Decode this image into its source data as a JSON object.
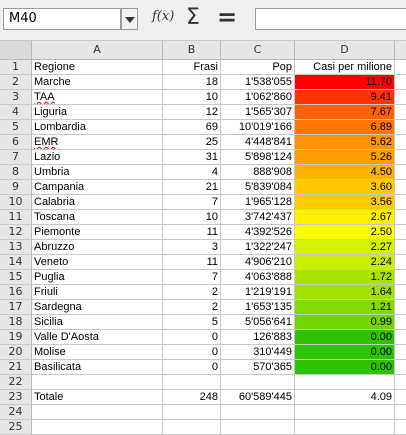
{
  "formula_bar": {
    "cell_ref": "M40",
    "fx_label": "f(x)",
    "sum_label": "Σ",
    "equals_label": "="
  },
  "columns": [
    "A",
    "B",
    "C",
    "D"
  ],
  "header_row": {
    "num": "1",
    "a": "Regione",
    "b": "Frasi",
    "c": "Pop",
    "d": "Casi per milione"
  },
  "rows": [
    {
      "num": "2",
      "a": "Marche",
      "b": "18",
      "c": "1'538'055",
      "d": "11.70",
      "color": "#ff0000"
    },
    {
      "num": "3",
      "a": "TAA",
      "b": "10",
      "c": "1'062'860",
      "d": "9.41",
      "color": "#ff3300"
    },
    {
      "num": "4",
      "a": "Liguria",
      "b": "12",
      "c": "1'565'307",
      "d": "7.67",
      "color": "#ff6200"
    },
    {
      "num": "5",
      "a": "Lombardia",
      "b": "69",
      "c": "10'019'166",
      "d": "6.89",
      "color": "#ff7600"
    },
    {
      "num": "6",
      "a": "EMR",
      "b": "25",
      "c": "4'448'841",
      "d": "5.62",
      "color": "#ff9400"
    },
    {
      "num": "7",
      "a": "Lazio",
      "b": "31",
      "c": "5'898'124",
      "d": "5.26",
      "color": "#ff9d00"
    },
    {
      "num": "8",
      "a": "Umbria",
      "b": "4",
      "c": "888'908",
      "d": "4.50",
      "color": "#ffb100"
    },
    {
      "num": "9",
      "a": "Campania",
      "b": "21",
      "c": "5'839'084",
      "d": "3.60",
      "color": "#ffc800"
    },
    {
      "num": "10",
      "a": "Calabria",
      "b": "7",
      "c": "1'965'128",
      "d": "3.56",
      "color": "#ffca00"
    },
    {
      "num": "11",
      "a": "Toscana",
      "b": "10",
      "c": "3'742'437",
      "d": "2.67",
      "color": "#fff000"
    },
    {
      "num": "12",
      "a": "Piemonte",
      "b": "11",
      "c": "4'392'526",
      "d": "2.50",
      "color": "#ffff00"
    },
    {
      "num": "13",
      "a": "Abruzzo",
      "b": "3",
      "c": "1'322'247",
      "d": "2.27",
      "color": "#d4f200"
    },
    {
      "num": "14",
      "a": "Veneto",
      "b": "11",
      "c": "4'906'210",
      "d": "2.24",
      "color": "#ccee00"
    },
    {
      "num": "15",
      "a": "Puglia",
      "b": "7",
      "c": "4'063'888",
      "d": "1.72",
      "color": "#a8e400"
    },
    {
      "num": "16",
      "a": "Friuli",
      "b": "2",
      "c": "1'219'191",
      "d": "1.64",
      "color": "#a2e200"
    },
    {
      "num": "17",
      "a": "Sardegna",
      "b": "2",
      "c": "1'653'135",
      "d": "1.21",
      "color": "#82da00"
    },
    {
      "num": "18",
      "a": "Sicilia",
      "b": "5",
      "c": "5'056'641",
      "d": "0.99",
      "color": "#72d400"
    },
    {
      "num": "19",
      "a": "Valle D'Aosta",
      "b": "0",
      "c": "126'883",
      "d": "0.00",
      "color": "#2ec300"
    },
    {
      "num": "20",
      "a": "Molise",
      "b": "0",
      "c": "310'449",
      "d": "0.00",
      "color": "#2ec300"
    },
    {
      "num": "21",
      "a": "Basilicata",
      "b": "0",
      "c": "570'365",
      "d": "0.00",
      "color": "#2ec300"
    },
    {
      "num": "22",
      "a": "",
      "b": "",
      "c": "",
      "d": "",
      "color": ""
    },
    {
      "num": "23",
      "a": "Totale",
      "b": "248",
      "c": "60'589'445",
      "d": "4.09",
      "color": ""
    },
    {
      "num": "24",
      "a": "",
      "b": "",
      "c": "",
      "d": "",
      "color": ""
    },
    {
      "num": "25",
      "a": "",
      "b": "",
      "c": "",
      "d": "",
      "color": ""
    }
  ]
}
